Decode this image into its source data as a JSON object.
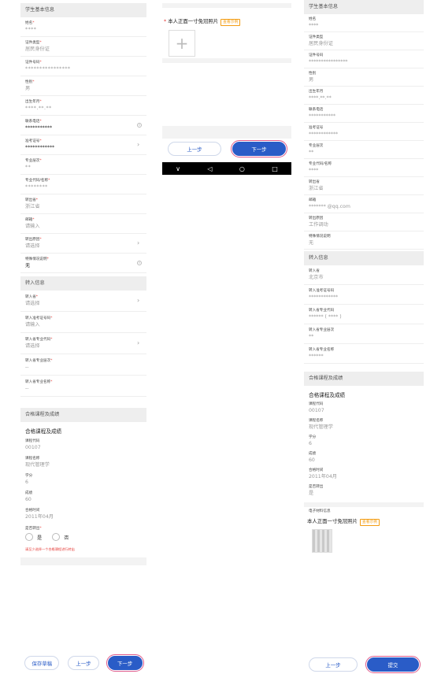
{
  "p1": {
    "section_basic": "学生基本信息",
    "fields": [
      {
        "label": "姓名",
        "req": "*",
        "value": "****",
        "style": "mask"
      },
      {
        "label": "证件类型",
        "req": "*",
        "value": "居民身份证",
        "style": ""
      },
      {
        "label": "证件号码",
        "req": "*",
        "value": "****************",
        "style": "mask"
      },
      {
        "label": "性别",
        "req": "*",
        "value": "男",
        "style": ""
      },
      {
        "label": "出生年月",
        "req": "*",
        "value": "****.**.**",
        "style": "mask"
      },
      {
        "label": "联系电话",
        "req": "*",
        "value": "***********",
        "style": "dark",
        "icon": "clear"
      },
      {
        "label": "准考证号",
        "req": "*",
        "value": "************",
        "style": "dark",
        "icon": "chevron"
      },
      {
        "label": "专业层次",
        "req": "*",
        "value": "**",
        "style": "mask"
      },
      {
        "label": "专业代码/名称",
        "req": "*",
        "value": "********",
        "style": "mask"
      },
      {
        "label": "转出省",
        "req": "*",
        "value": "浙江省",
        "style": ""
      },
      {
        "label": "邮箱",
        "req": "*",
        "value": "请输入",
        "style": ""
      },
      {
        "label": "转出原因",
        "req": "*",
        "value": "请选择",
        "style": "",
        "icon": "chevron"
      },
      {
        "label": "特殊情况说明",
        "req": "*",
        "value": "无",
        "style": "dark",
        "icon": "clear"
      }
    ],
    "section_transfer": "转入信息",
    "transfer_fields": [
      {
        "label": "转入省",
        "req": "*",
        "value": "请选择",
        "icon": "chevron"
      },
      {
        "label": "转入准考证号码",
        "req": "*",
        "value": "请输入"
      },
      {
        "label": "转入省专业代码",
        "req": "*",
        "value": "请选择",
        "icon": "chevron"
      },
      {
        "label": "转入省专业层次",
        "req": "*",
        "value": "--"
      },
      {
        "label": "转入省专业名称",
        "req": "*",
        "value": "--"
      }
    ],
    "section_course": "合格课程及成绩",
    "course_title": "合格课程及成绩",
    "course_fields": [
      {
        "label": "课程代码",
        "value": "00107"
      },
      {
        "label": "课程名称",
        "value": "现代管理学"
      },
      {
        "label": "学分",
        "value": "6"
      },
      {
        "label": "成绩",
        "value": "60"
      },
      {
        "label": "合格时间",
        "value": "2011年04月"
      }
    ],
    "convert_label": "是否转出",
    "convert_req": "*",
    "radio_yes": "是",
    "radio_no": "否",
    "warning": "请至少选择一个合格课程进行转出",
    "btn_draft": "保存草稿",
    "btn_prev": "上一步",
    "btn_next": "下一步"
  },
  "p2": {
    "photo_req": "*",
    "photo_label": "本人正面一寸免冠照片",
    "photo_tag": "查看示例",
    "btn_prev": "上一步",
    "btn_next": "下一步",
    "nav_icons": [
      "chevron-down-icon",
      "back-triangle-icon",
      "home-circle-icon",
      "recent-square-icon"
    ],
    "nav_glyphs": [
      "∨",
      "◁",
      "○",
      "□"
    ]
  },
  "p3": {
    "section_basic": "学生基本信息",
    "fields": [
      {
        "label": "姓名",
        "value": "****"
      },
      {
        "label": "证件类型",
        "value": "居民身份证"
      },
      {
        "label": "证件号码",
        "value": "****************"
      },
      {
        "label": "性别",
        "value": "男"
      },
      {
        "label": "出生年月",
        "value": "****.**.**"
      },
      {
        "label": "联系电话",
        "value": "***********"
      },
      {
        "label": "准考证号",
        "value": "************"
      },
      {
        "label": "专业层次",
        "value": "**"
      },
      {
        "label": "专业代码/名称",
        "value": "****"
      },
      {
        "label": "转出省",
        "value": "浙江省"
      },
      {
        "label": "邮箱",
        "value": "******* @qq.com"
      },
      {
        "label": "转出原因",
        "value": "工作调动"
      },
      {
        "label": "特殊情况说明",
        "value": "无"
      }
    ],
    "section_transfer": "转入信息",
    "transfer_fields": [
      {
        "label": "转入省",
        "value": "北京市"
      },
      {
        "label": "转入准考证号码",
        "value": "************"
      },
      {
        "label": "转入省专业代码",
        "value": "****** (   **** )"
      },
      {
        "label": "转入省专业层次",
        "value": "**"
      },
      {
        "label": "转入省专业名称",
        "value": "******"
      }
    ],
    "section_course": "合格课程及成绩",
    "course_title": "合格课程及成绩",
    "course_fields": [
      {
        "label": "课程代码",
        "value": "00107"
      },
      {
        "label": "课程名称",
        "value": "现代管理学"
      },
      {
        "label": "学分",
        "value": "6"
      },
      {
        "label": "成绩",
        "value": "60"
      },
      {
        "label": "合格时间",
        "value": "2011年04月"
      },
      {
        "label": "是否转出",
        "value": "是"
      }
    ],
    "section_materials": "电子材料信息",
    "photo_label": "本人正面一寸免冠照片",
    "photo_tag": "查看示例",
    "btn_prev": "上一步",
    "btn_submit": "提交"
  }
}
